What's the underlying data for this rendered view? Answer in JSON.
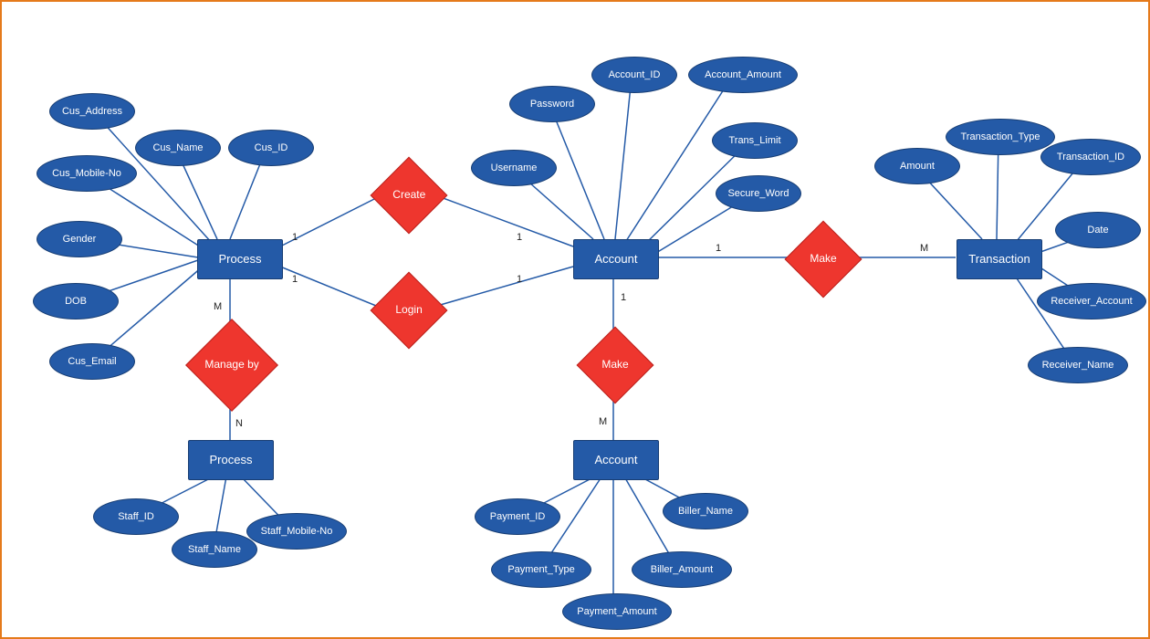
{
  "entities": {
    "process_top": "Process",
    "process_bot": "Process",
    "account_top": "Account",
    "account_bot": "Account",
    "transaction": "Transaction"
  },
  "relationships": {
    "create": "Create",
    "login": "Login",
    "manage_by": "Manage by",
    "make_side": "Make",
    "make_down": "Make"
  },
  "attrs": {
    "process": {
      "cus_address": "Cus_Address",
      "cus_name": "Cus_Name",
      "cus_id": "Cus_ID",
      "cus_mobile_no": "Cus_Mobile-No",
      "gender": "Gender",
      "dob": "DOB",
      "cus_email": "Cus_Email"
    },
    "staff": {
      "staff_id": "Staff_ID",
      "staff_name": "Staff_Name",
      "staff_mobile_no": "Staff_Mobile-No"
    },
    "account": {
      "username": "Username",
      "password": "Password",
      "account_id": "Account_ID",
      "account_amt": "Account_Amount",
      "trans_limit": "Trans_Limit",
      "secure_word": "Secure_Word"
    },
    "payment": {
      "payment_id": "Payment_ID",
      "payment_type": "Payment_Type",
      "payment_amount": "Payment_Amount",
      "biller_amount": "Biller_Amount",
      "biller_name": "Biller_Name"
    },
    "transaction": {
      "amount": "Amount",
      "transaction_type": "Transaction_Type",
      "transaction_id": "Transaction_ID",
      "date": "Date",
      "receiver_account": "Receiver_Account",
      "receiver_name": "Receiver_Name"
    }
  },
  "cardinality": {
    "process_create": "1",
    "account_create": "1",
    "process_login": "1",
    "account_login": "1",
    "process_manage": "M",
    "staff_manage": "N",
    "account_make_side": "1",
    "transaction_make_side": "M",
    "account_make_down": "1",
    "payment_make_down": "M"
  }
}
